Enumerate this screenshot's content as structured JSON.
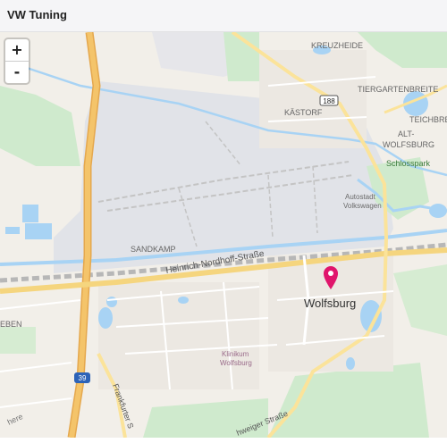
{
  "header": {
    "title": "VW Tuning"
  },
  "zoom": {
    "in_label": "+",
    "out_label": "-"
  },
  "colors": {
    "land": "#f2efe9",
    "industrial": "#e1e3e8",
    "water": "#a8d3f4",
    "green": "#cfeacd",
    "highway": "#f4c46a",
    "primary": "#fbe39a",
    "rail": "#b7b7b7",
    "marker": "#e0156c"
  },
  "map": {
    "labels": {
      "kreuzheide": "KREUZHEIDE",
      "tiergartenbreite": "TIERGARTENBREITE",
      "kastorf": "KÄSTORF",
      "teichbreite": "TEICHBRE",
      "alt_wolfsburg_1": "ALT-",
      "alt_wolfsburg_2": "WOLFSBURG",
      "schlosspark": "Schlosspark",
      "autostadt_1": "Autostadt",
      "autostadt_2": "Volkswagen",
      "sandkamp": "SANDKAMP",
      "heinrich_nordhoff": "Heinrich-Nordhoff-Straße",
      "wolfsburg": "Wolfsburg",
      "klinikum_1": "Klinikum",
      "klinikum_2": "Wolfsburg",
      "frankfurter": "Frankfurter S",
      "braunschweiger": "hweiger Straße",
      "leben": "EBEN",
      "here": "here",
      "road_188": "188",
      "road_39": "39"
    },
    "marker": {
      "icon": "map-pin-icon",
      "place": "Wolfsburg"
    }
  }
}
